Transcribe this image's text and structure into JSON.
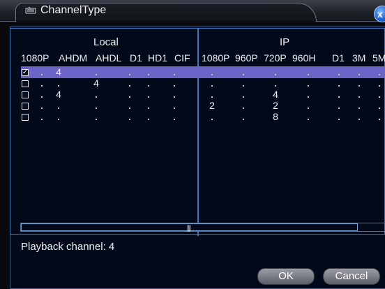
{
  "window": {
    "title": "ChannelType",
    "close_label": "x"
  },
  "groups": {
    "local": "Local",
    "ip": "IP"
  },
  "columns": {
    "local": [
      "1080P",
      "AHDM",
      "AHDL",
      "D1",
      "HD1",
      "CIF"
    ],
    "ip": [
      "1080P",
      "960P",
      "720P",
      "960H",
      "D1",
      "3M",
      "5M"
    ]
  },
  "rows": [
    {
      "checked": true,
      "local": [
        "",
        "4",
        "",
        "",
        "",
        ""
      ],
      "ip": [
        "",
        "",
        "",
        "",
        "",
        "",
        ""
      ]
    },
    {
      "checked": false,
      "local": [
        "",
        "",
        "4",
        "",
        "",
        ""
      ],
      "ip": [
        "",
        "",
        "",
        "",
        "",
        "",
        ""
      ]
    },
    {
      "checked": false,
      "local": [
        "",
        "4",
        "",
        "",
        "",
        ""
      ],
      "ip": [
        "",
        "",
        "4",
        "",
        "",
        "",
        ""
      ]
    },
    {
      "checked": false,
      "local": [
        "",
        "",
        "",
        "",
        "",
        ""
      ],
      "ip": [
        "2",
        "",
        "2",
        "",
        "",
        "",
        ""
      ]
    },
    {
      "checked": false,
      "local": [
        "",
        "",
        "",
        "",
        "",
        ""
      ],
      "ip": [
        "",
        "",
        "8",
        "",
        "",
        "",
        ""
      ]
    }
  ],
  "playback": "Playback channel: 4",
  "buttons": {
    "ok": "OK",
    "cancel": "Cancel"
  },
  "colors": {
    "accent": "#3c76b8",
    "selected_row": "#6c63c6",
    "panel_bg": "#02091a"
  }
}
